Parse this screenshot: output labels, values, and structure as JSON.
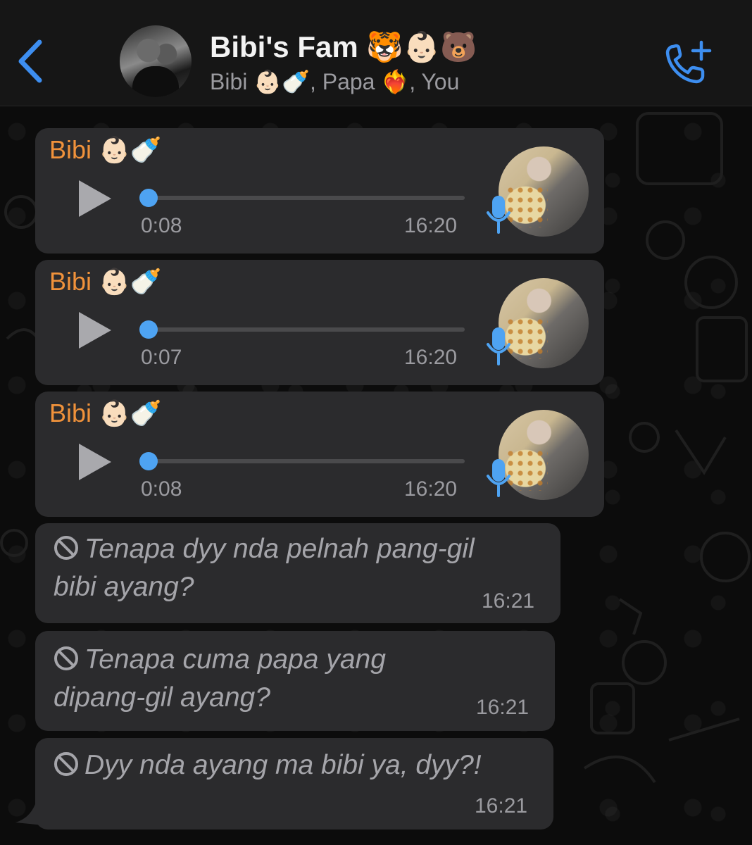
{
  "header": {
    "back_icon": "chevron-left-icon",
    "group_title": "Bibi's Fam 🐯👶🏻🐻",
    "members": "Bibi 👶🏻🍼, Papa ❤️‍🔥, You",
    "call_icon": "phone-plus-icon"
  },
  "messages": [
    {
      "type": "voice",
      "sender": "Bibi 👶🏻🍼",
      "duration": "0:08",
      "time": "16:20",
      "progress": 0
    },
    {
      "type": "voice",
      "sender": "Bibi 👶🏻🍼",
      "duration": "0:07",
      "time": "16:20",
      "progress": 0
    },
    {
      "type": "voice",
      "sender": "Bibi 👶🏻🍼",
      "duration": "0:08",
      "time": "16:20",
      "progress": 0
    },
    {
      "type": "deleted",
      "line1": "Tenapa dyy nda pelnah pang-gil",
      "line2": "bibi ayang?",
      "time": "16:21"
    },
    {
      "type": "deleted",
      "line1": "Tenapa cuma papa yang",
      "line2": "dipang-gil ayang?",
      "time": "16:21"
    },
    {
      "type": "deleted",
      "line1": "Dyy nda ayang ma bibi ya, dyy?!",
      "time": "16:21"
    }
  ],
  "colors": {
    "accent_blue": "#4ea3f2",
    "sender_orange": "#f0923b",
    "bubble": "#2b2b2d",
    "header_bg": "#161616"
  }
}
